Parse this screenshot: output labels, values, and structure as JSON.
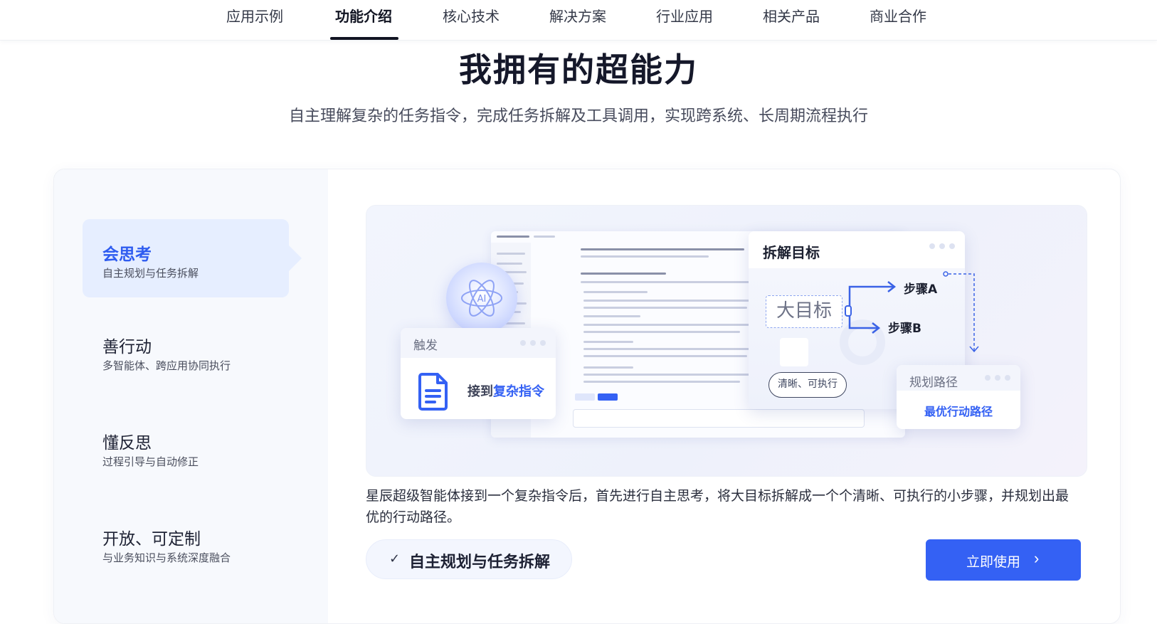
{
  "nav": {
    "items": [
      {
        "label": "应用示例",
        "active": false
      },
      {
        "label": "功能介绍",
        "active": true
      },
      {
        "label": "核心技术",
        "active": false
      },
      {
        "label": "解决方案",
        "active": false
      },
      {
        "label": "行业应用",
        "active": false
      },
      {
        "label": "相关产品",
        "active": false
      },
      {
        "label": "商业合作",
        "active": false
      }
    ]
  },
  "section": {
    "title": "我拥有的超能力",
    "subtitle": "自主理解复杂的任务指令，完成任务拆解及工具调用，实现跨系统、长周期流程执行"
  },
  "sidebar": {
    "items": [
      {
        "title": "会思考",
        "desc": "自主规划与任务拆解",
        "active": true
      },
      {
        "title": "善行动",
        "desc": "多智能体、跨应用协同执行",
        "active": false
      },
      {
        "title": "懂反思",
        "desc": "过程引导与自动修正",
        "active": false
      },
      {
        "title": "开放、可定制",
        "desc": "与业务知识与系统深度融合",
        "active": false
      }
    ]
  },
  "illustration": {
    "trigger": {
      "title": "触发",
      "text_prefix": "接到",
      "text_highlight": "复杂指令"
    },
    "goal": {
      "title": "拆解目标",
      "big_goal": "大目标",
      "step_a": "步骤A",
      "step_b": "步骤B",
      "pill": "清晰、可执行"
    },
    "path": {
      "title": "规划路径",
      "text": "最优行动路径"
    },
    "orb_label": "AI"
  },
  "content": {
    "description": "星辰超级智能体接到一个复杂指令后，首先进行自主思考，将大目标拆解成一个个清晰、可执行的小步骤，并规划出最优的行动路径。",
    "tag_check": "✓",
    "tag_label": "自主规划与任务拆解",
    "cta_label": "立即使用",
    "cta_arrow": "›"
  },
  "colors": {
    "accent": "#3461f4",
    "active_bg": "#e6eeff",
    "sidebar_bg": "#f7f9fd"
  }
}
